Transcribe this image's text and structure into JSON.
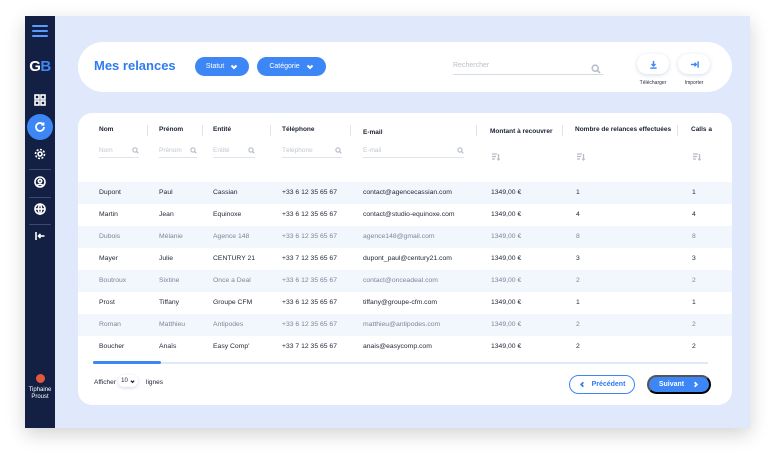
{
  "app": {
    "logo_g": "G",
    "logo_b": "B",
    "user_name_line1": "Tiphaine",
    "user_name_line2": "Proust"
  },
  "header": {
    "title": "Mes relances",
    "filter_status_label": "Statut",
    "filter_category_label": "Catégorie",
    "search_placeholder": "Rechercher",
    "download_label": "Télécharger",
    "import_label": "Importer"
  },
  "table": {
    "columns": [
      "Nom",
      "Prénom",
      "Entité",
      "Téléphone",
      "E-mail",
      "Montant à recouvrer",
      "Nombre de relances effectuées",
      "Calls a"
    ],
    "filters": {
      "nom": "Nom",
      "prenom": "Prénom",
      "entite": "Entité",
      "telephone": "Téléphone",
      "email": "E-mail"
    },
    "rows": [
      {
        "nom": "Dupont",
        "prenom": "Paul",
        "entite": "Cassian",
        "tel": "+33 6 12 35 65 67",
        "email": "contact@agencecassian.com",
        "montant": "1349,00 €",
        "relances": "1",
        "calls": "1"
      },
      {
        "nom": "Martin",
        "prenom": "Jean",
        "entite": "Equinoxe",
        "tel": "+33 6 12 35 65 67",
        "email": "contact@studio-equinoxe.com",
        "montant": "1349,00 €",
        "relances": "4",
        "calls": "4"
      },
      {
        "nom": "Dubois",
        "prenom": "Mélanie",
        "entite": "Agence 148",
        "tel": "+33 6 12 35 65 67",
        "email": "agence148@gmail.com",
        "montant": "1349,00 €",
        "relances": "8",
        "calls": "8"
      },
      {
        "nom": "Mayer",
        "prenom": "Julie",
        "entite": "CENTURY 21",
        "tel": "+33 7 12 35 65 67",
        "email": "dupont_paul@century21.com",
        "montant": "1349,00 €",
        "relances": "3",
        "calls": "3"
      },
      {
        "nom": "Boutroux",
        "prenom": "Sixtine",
        "entite": "Once a Deal",
        "tel": "+33 6 12 35 65 67",
        "email": "contact@onceadeal.com",
        "montant": "1349,00 €",
        "relances": "2",
        "calls": "2"
      },
      {
        "nom": "Prost",
        "prenom": "Tiffany",
        "entite": "Groupe CFM",
        "tel": "+33 6 12 35 65 67",
        "email": "tiffany@groupe-cfm.com",
        "montant": "1349,00 €",
        "relances": "1",
        "calls": "1"
      },
      {
        "nom": "Roman",
        "prenom": "Matthieu",
        "entite": "Antipodes",
        "tel": "+33 6 12 35 65 67",
        "email": "matthieu@antipodes.com",
        "montant": "1349,00 €",
        "relances": "2",
        "calls": "2"
      },
      {
        "nom": "Boucher",
        "prenom": "Anaïs",
        "entite": "Easy Comp'",
        "tel": "+33 7 12 35 65 67",
        "email": "anais@easycomp.com",
        "montant": "1349,00 €",
        "relances": "2",
        "calls": "2"
      }
    ]
  },
  "footer": {
    "show_label": "Afficher",
    "page_size": "10",
    "lines_label": "lignes",
    "prev_label": "Précédent",
    "next_label": "Suivant"
  },
  "colors": {
    "accent": "#3d86f5",
    "sidebar": "#132043",
    "background": "#dfe9fb"
  }
}
